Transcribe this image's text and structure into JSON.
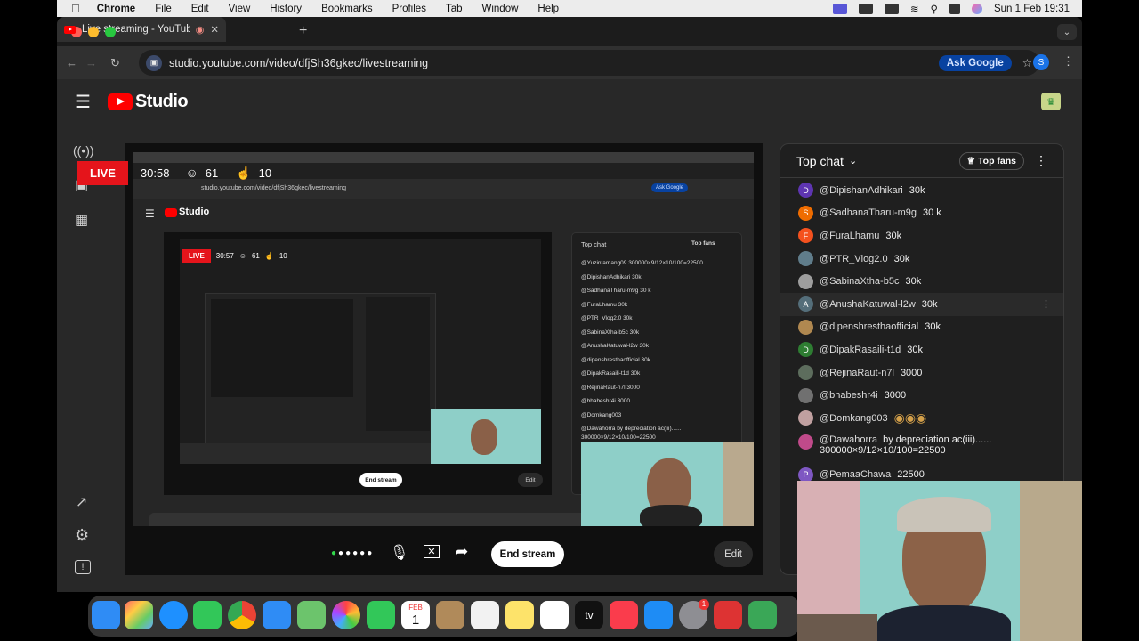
{
  "menubar": {
    "app": "Chrome",
    "items": [
      "File",
      "Edit",
      "View",
      "History",
      "Bookmarks",
      "Profiles",
      "Tab",
      "Window",
      "Help"
    ],
    "clock": "Sun 1 Feb  19:31"
  },
  "tab": {
    "title": "Live streaming - YouTube"
  },
  "address": {
    "url": "studio.youtube.com/video/dfjSh36gkec/livestreaming",
    "ask_google": "Ask Google",
    "profile_initial": "S"
  },
  "studio": {
    "logo_text": "Studio"
  },
  "overlay": {
    "live_label": "LIVE",
    "elapsed": "30:58",
    "viewers": "61",
    "likes": "10"
  },
  "controls": {
    "end_stream": "End stream",
    "edit": "Edit"
  },
  "chat": {
    "header": "Top chat",
    "top_fans": "Top fans",
    "messages": [
      {
        "initial": "D",
        "color": "#5e35b1",
        "author": "@DipishanAdhikari",
        "text": "30k"
      },
      {
        "initial": "S",
        "color": "#ef6c00",
        "author": "@SadhanaTharu-m9g",
        "text": "30 k"
      },
      {
        "initial": "F",
        "color": "#f4511e",
        "author": "@FuraLhamu",
        "text": "30k"
      },
      {
        "initial": "",
        "color": "#607d8b",
        "author": "@PTR_Vlog2.0",
        "text": "30k"
      },
      {
        "initial": "",
        "color": "#9e9e9e",
        "author": "@SabinaXtha-b5c",
        "text": "30k"
      },
      {
        "initial": "A",
        "color": "#546e7a",
        "author": "@AnushaKatuwal-l2w",
        "text": "30k"
      },
      {
        "initial": "",
        "color": "#b08850",
        "author": "@dipenshresthaofficial",
        "text": "30k"
      },
      {
        "initial": "D",
        "color": "#2e7d32",
        "author": "@DipakRasaili-t1d",
        "text": "30k"
      },
      {
        "initial": "",
        "color": "#5d6d5d",
        "author": "@RejinaRaut-n7l",
        "text": "3000"
      },
      {
        "initial": "",
        "color": "#707070",
        "author": "@bhabeshr4i",
        "text": "3000"
      },
      {
        "initial": "",
        "color": "#c0a0a0",
        "author": "@Domkang003",
        "text": ""
      },
      {
        "initial": "",
        "color": "#c04a8a",
        "author": "@Dawahorra",
        "text": "by depreciation ac(iii)......",
        "text2": "300000×9/12×10/100=22500"
      },
      {
        "initial": "P",
        "color": "#7e57c2",
        "author": "@PemaaChawa",
        "text": "22500"
      }
    ]
  },
  "nested": {
    "url": "studio.youtube.com/video/dfjSh36gkec/livestreaming",
    "ask_google": "Ask Google",
    "live_label": "LIVE",
    "elapsed": "30:57",
    "viewers": "61",
    "likes": "10",
    "header": "Top chat",
    "top_fans": "Top fans",
    "end_stream": "End stream",
    "edit": "Edit",
    "chat": [
      "@Yuzintamang09  300000×9/12×10/100=22500",
      "@DipishanAdhikari  30k",
      "@SadhanaTharu-m9g  30 k",
      "@FuraLhamu  30k",
      "@PTR_Vlog2.0  30k",
      "@SabinaXtha-b5c  30k",
      "@AnushaKatuwal-l2w  30k",
      "@dipenshresthaofficial  30k",
      "@DipakRasaili-t1d  30k",
      "@RejinaRaut-n7l  3000",
      "@bhabeshr4i  3000",
      "@Domkang003",
      "@Dawahorra  by depreciation ac(iii)......",
      "300000×9/12×10/100=22500"
    ]
  },
  "dock": {
    "calendar_month": "FEB",
    "calendar_day": "1",
    "apple_tv": "tv",
    "badge": "1"
  },
  "colors": {
    "live_red": "#e5141b",
    "youtube_red": "#ff0000",
    "studio_bg": "#282828"
  }
}
